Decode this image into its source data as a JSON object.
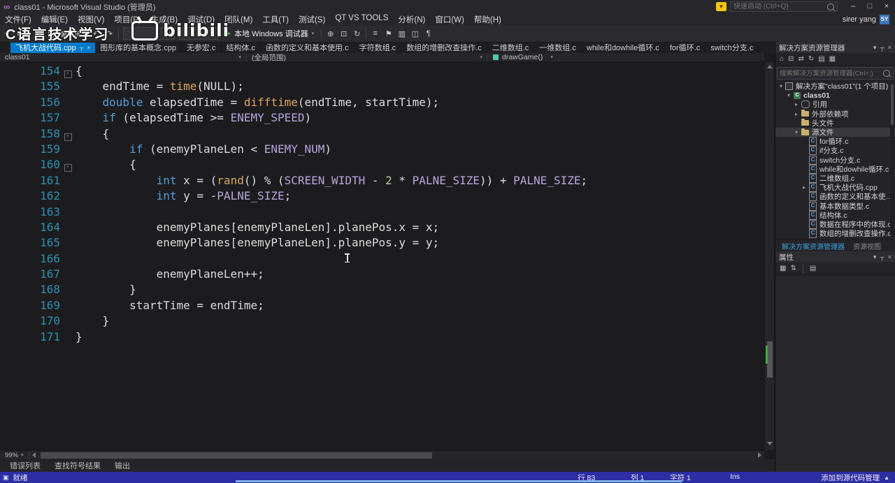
{
  "colors": {
    "accent": "#007ACC",
    "statusbar": "#2D2DA4",
    "chrome": "#27272B",
    "editor-bg": "#1C1C1E",
    "panel-bg": "#242428",
    "keyword": "#569CD6",
    "func": "#D7A65F",
    "macro": "#B8A5DC",
    "number": "#B5CEA8",
    "plain": "#DCDCDC",
    "line-number": "#2B91AF",
    "debug-green": "#3DBE3D"
  },
  "icons": {
    "chevron_down": "▾",
    "chevron_right": "▸",
    "pin": "┬",
    "close": "×"
  },
  "window": {
    "logo_glyph": "∞",
    "title": "class01 - Microsoft Visual Studio (管理员)",
    "update_glyph": "▼",
    "quick_launch_placeholder": "快速启动 (Ctrl+Q)",
    "user_name": "sirer yang",
    "user_avatar": "SY",
    "controls": [
      {
        "name": "minimize-button",
        "glyph": "–"
      },
      {
        "name": "maximize-button",
        "glyph": "□"
      },
      {
        "name": "close-button",
        "glyph": "×"
      }
    ]
  },
  "menus": [
    "文件(F)",
    "编辑(E)",
    "视图(V)",
    "项目(P)",
    "生成(B)",
    "调试(D)",
    "团队(M)",
    "工具(T)",
    "测试(S)",
    "QT VS TOOLS",
    "分析(N)",
    "窗口(W)",
    "帮助(H)"
  ],
  "watermark": {
    "text": "C语言技术学习",
    "logo_text": "bilibili"
  },
  "toolbar": {
    "debug_label": "本地 Windows 调试器",
    "left_icons": [
      {
        "name": "navigate-back-icon",
        "glyph": "◄"
      },
      {
        "name": "navigate-forward-icon",
        "glyph": "►"
      },
      {
        "sep": true
      },
      {
        "name": "new-project-icon",
        "glyph": "□"
      },
      {
        "name": "open-file-icon",
        "glyph": "▤"
      },
      {
        "name": "save-icon",
        "glyph": "▦"
      },
      {
        "name": "save-all-icon",
        "glyph": "⊞"
      },
      {
        "sep": true
      },
      {
        "name": "undo-icon",
        "glyph": "↶"
      },
      {
        "name": "redo-icon",
        "glyph": "↷"
      },
      {
        "sep": true
      }
    ],
    "right_icons": [
      {
        "sep": true
      },
      {
        "name": "attach-to-process-icon",
        "glyph": "⊕"
      },
      {
        "name": "breakpoints-window-icon",
        "glyph": "⊡"
      },
      {
        "name": "refresh-icon",
        "glyph": "↻"
      },
      {
        "sep": true
      },
      {
        "name": "immediate-window-icon",
        "glyph": "≡"
      },
      {
        "name": "bookmark-icon",
        "glyph": "⚑"
      },
      {
        "name": "comment-icon",
        "glyph": "▥"
      },
      {
        "name": "uncomment-icon",
        "glyph": "◫"
      },
      {
        "name": "formatting-icon",
        "glyph": "¶"
      }
    ]
  },
  "tabs": [
    {
      "label": "飞机大战代码.cpp",
      "active": true
    },
    {
      "label": "图形库的基本概念.cpp",
      "active": false
    },
    {
      "label": "无参宏.c",
      "active": false
    },
    {
      "label": "结构体.c",
      "active": false
    },
    {
      "label": "函数的定义和基本使用.c",
      "active": false
    },
    {
      "label": "字符数组.c",
      "active": false
    },
    {
      "label": "数组的增删改查操作.c",
      "active": false
    },
    {
      "label": "二维数组.c",
      "active": false
    },
    {
      "label": "一维数组.c",
      "active": false
    },
    {
      "label": "while和dowhile循环.c",
      "active": false
    },
    {
      "label": "for循环.c",
      "active": false
    },
    {
      "label": "switch分支.c",
      "active": false
    }
  ],
  "breadcrumb": {
    "project": "class01",
    "scope": "(全局范围)",
    "method": "drawGame()"
  },
  "editor": {
    "zoom_label": "99%",
    "fold_glyph": "-",
    "lines": [
      {
        "n": 154,
        "fold": true,
        "segs": [
          [
            "{",
            "p"
          ]
        ]
      },
      {
        "n": 155,
        "segs": [
          [
            "    endTime = ",
            "p"
          ],
          [
            "time",
            "f"
          ],
          [
            "(NULL);",
            "p"
          ]
        ]
      },
      {
        "n": 156,
        "segs": [
          [
            "    ",
            "p"
          ],
          [
            "double",
            "k"
          ],
          [
            " elapsedTime = ",
            "p"
          ],
          [
            "difftime",
            "f"
          ],
          [
            "(endTime, startTime);",
            "p"
          ]
        ]
      },
      {
        "n": 157,
        "segs": [
          [
            "    ",
            "p"
          ],
          [
            "if",
            "k"
          ],
          [
            " (elapsedTime >= ",
            "p"
          ],
          [
            "ENEMY_SPEED",
            "m"
          ],
          [
            ")",
            "p"
          ]
        ]
      },
      {
        "n": 158,
        "fold": true,
        "segs": [
          [
            "    {",
            "p"
          ]
        ]
      },
      {
        "n": 159,
        "segs": [
          [
            "        ",
            "p"
          ],
          [
            "if",
            "k"
          ],
          [
            " (enemyPlaneLen < ",
            "p"
          ],
          [
            "ENEMY_NUM",
            "m"
          ],
          [
            ")",
            "p"
          ]
        ]
      },
      {
        "n": 160,
        "fold": true,
        "segs": [
          [
            "        {",
            "p"
          ]
        ]
      },
      {
        "n": 161,
        "segs": [
          [
            "            ",
            "p"
          ],
          [
            "int",
            "k"
          ],
          [
            " x = (",
            "p"
          ],
          [
            "rand",
            "f"
          ],
          [
            "() % (",
            "p"
          ],
          [
            "SCREEN_WIDTH",
            "m"
          ],
          [
            " - ",
            "p"
          ],
          [
            "2",
            "n"
          ],
          [
            " * ",
            "p"
          ],
          [
            "PALNE_SIZE",
            "m"
          ],
          [
            ")) + ",
            "p"
          ],
          [
            "PALNE_SIZE",
            "m"
          ],
          [
            ";",
            "p"
          ]
        ]
      },
      {
        "n": 162,
        "segs": [
          [
            "            ",
            "p"
          ],
          [
            "int",
            "k"
          ],
          [
            " y = -",
            "p"
          ],
          [
            "PALNE_SIZE",
            "m"
          ],
          [
            ";",
            "p"
          ]
        ]
      },
      {
        "n": 163,
        "segs": []
      },
      {
        "n": 164,
        "segs": [
          [
            "            enemyPlanes[enemyPlaneLen].planePos.x = x;",
            "p"
          ]
        ]
      },
      {
        "n": 165,
        "segs": [
          [
            "            enemyPlanes[enemyPlaneLen].planePos.y = y;",
            "p"
          ]
        ]
      },
      {
        "n": 166,
        "segs": []
      },
      {
        "n": 167,
        "segs": [
          [
            "            enemyPlaneLen++;",
            "p"
          ]
        ]
      },
      {
        "n": 168,
        "segs": [
          [
            "        }",
            "p"
          ]
        ]
      },
      {
        "n": 169,
        "segs": [
          [
            "        startTime = endTime;",
            "p"
          ]
        ]
      },
      {
        "n": 170,
        "segs": [
          [
            "    }",
            "p"
          ]
        ]
      },
      {
        "n": 171,
        "segs": [
          [
            "}",
            "p"
          ]
        ]
      }
    ]
  },
  "solution_explorer": {
    "title": "解决方案资源管理器",
    "header_icons": [
      {
        "name": "window-position-icon",
        "glyph": "▾"
      },
      {
        "name": "pin-icon",
        "glyph": "┬"
      },
      {
        "name": "close-icon",
        "glyph": "×"
      }
    ],
    "tool_icons": [
      {
        "name": "home-icon",
        "glyph": "⌂"
      },
      {
        "name": "collapse-all-icon",
        "glyph": "⊟"
      },
      {
        "name": "sync-with-active-document-icon",
        "glyph": "⇄"
      },
      {
        "name": "refresh-icon",
        "glyph": "↻"
      },
      {
        "name": "show-all-files-icon",
        "glyph": "▤"
      },
      {
        "name": "properties-icon",
        "glyph": "▦"
      }
    ],
    "search_placeholder": "搜索解决方案资源管理器(Ctrl+;)",
    "tree": [
      {
        "label": "解决方案\"class01\"(1 个项目)",
        "level": 0,
        "arrow": "down",
        "icon": "solution"
      },
      {
        "label": "class01",
        "level": 1,
        "arrow": "down",
        "icon": "project",
        "bold": true
      },
      {
        "label": "引用",
        "level": 2,
        "arrow": "right",
        "icon": "refs"
      },
      {
        "label": "外部依赖项",
        "level": 2,
        "arrow": "right",
        "icon": "folder"
      },
      {
        "label": "头文件",
        "level": 2,
        "arrow": "none",
        "icon": "folder"
      },
      {
        "label": "源文件",
        "level": 2,
        "arrow": "down",
        "icon": "folder",
        "selected": true
      },
      {
        "label": "for循环.c",
        "level": 3,
        "arrow": "none",
        "icon": "cfile"
      },
      {
        "label": "if分支.c",
        "level": 3,
        "arrow": "none",
        "icon": "cfile"
      },
      {
        "label": "switch分支.c",
        "level": 3,
        "arrow": "none",
        "icon": "cfile"
      },
      {
        "label": "while和dowhile循环.c",
        "level": 3,
        "arrow": "none",
        "icon": "cfile"
      },
      {
        "label": "二维数组.c",
        "level": 3,
        "arrow": "none",
        "icon": "cfile"
      },
      {
        "label": "飞机大战代码.cpp",
        "level": 3,
        "arrow": "right",
        "icon": "cfile"
      },
      {
        "label": "函数的定义和基本使用.c",
        "level": 3,
        "arrow": "none",
        "icon": "cfile"
      },
      {
        "label": "基本数据类型.c",
        "level": 3,
        "arrow": "none",
        "icon": "cfile"
      },
      {
        "label": "结构体.c",
        "level": 3,
        "arrow": "none",
        "icon": "cfile"
      },
      {
        "label": "数据在程序中的体现.c",
        "level": 3,
        "arrow": "none",
        "icon": "cfile"
      },
      {
        "label": "数组的增删改查操作.c",
        "level": 3,
        "arrow": "none",
        "icon": "cfile"
      }
    ],
    "dock_tabs": [
      {
        "label": "解决方案资源管理器",
        "active": true
      },
      {
        "label": "资源视图",
        "active": false
      }
    ]
  },
  "properties": {
    "title": "属性",
    "header_icons": [
      {
        "name": "window-position-icon",
        "glyph": "▾"
      },
      {
        "name": "pin-icon",
        "glyph": "┬"
      },
      {
        "name": "close-icon",
        "glyph": "×"
      }
    ],
    "tool_icons": [
      {
        "name": "categorized-icon",
        "glyph": "▦"
      },
      {
        "name": "alphabetical-icon",
        "glyph": "⇅"
      },
      {
        "sep": true
      },
      {
        "name": "property-pages-icon",
        "glyph": "▤"
      }
    ]
  },
  "bottom_panel_tabs": [
    "错误列表",
    "查找符号结果",
    "输出"
  ],
  "status_bar": {
    "ready": "就绪",
    "cells": [
      {
        "name": "status-line",
        "label": "行 83",
        "cls": "sb-line"
      },
      {
        "name": "status-column",
        "label": "列 1",
        "cls": "sb-col"
      },
      {
        "name": "status-character",
        "label": "字符 1",
        "cls": "sb-ch"
      },
      {
        "name": "status-insert-mode",
        "label": "Ins",
        "cls": "sb-ins"
      }
    ],
    "source_control": "添加到源代码管理",
    "caret": "▲"
  }
}
